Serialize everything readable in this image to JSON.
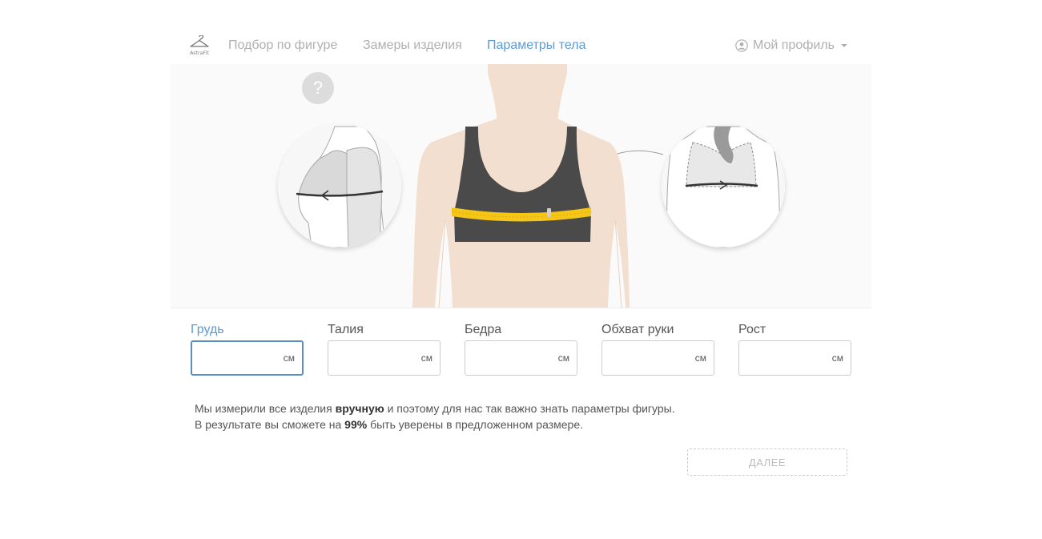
{
  "header": {
    "logo_text": "AstraFit",
    "nav": [
      {
        "label": "Подбор по фигуре",
        "active": false
      },
      {
        "label": "Замеры изделия",
        "active": false
      },
      {
        "label": "Параметры тела",
        "active": true
      }
    ],
    "profile_label": "Мой профиль"
  },
  "illustration": {
    "help_label": "?"
  },
  "form": {
    "fields": [
      {
        "label": "Грудь",
        "unit": "см",
        "value": "",
        "active": true
      },
      {
        "label": "Талия",
        "unit": "см",
        "value": "",
        "active": false
      },
      {
        "label": "Бедра",
        "unit": "см",
        "value": "",
        "active": false
      },
      {
        "label": "Обхват руки",
        "unit": "см",
        "value": "",
        "active": false
      },
      {
        "label": "Рост",
        "unit": "см",
        "value": "",
        "active": false
      }
    ]
  },
  "info": {
    "line1_a": "Мы измерили все изделия ",
    "line1_bold": "вручную",
    "line1_b": " и поэтому для нас так важно знать параметры фигуры.",
    "line2_a": "В результате вы сможете на ",
    "line2_bold": "99%",
    "line2_b": " быть уверены в предложенном размере."
  },
  "next_button": "ДАЛЕЕ",
  "colors": {
    "accent": "#5b9bd5",
    "skin": "#f2dfcf",
    "bra": "#4a4a4a",
    "tape": "#f5c518",
    "muted": "#b0b0b0"
  }
}
